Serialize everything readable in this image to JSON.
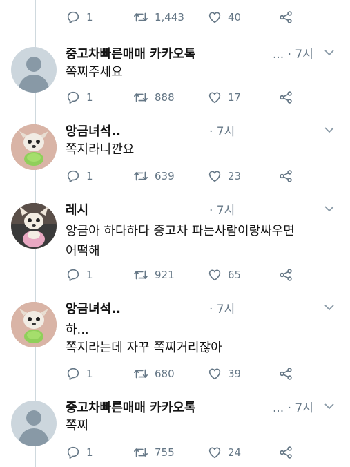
{
  "top_actions": {
    "reply": "1",
    "retweet": "1,443",
    "like": "40"
  },
  "tweets": [
    {
      "name": "중고차빠른매매 카카오톡",
      "meta": "... · 7시",
      "text_lines": [
        "쪽찌주세요"
      ],
      "reply": "1",
      "retweet": "888",
      "like": "17",
      "avatar": "default"
    },
    {
      "name": "앙금녀석..",
      "meta": "· 7시",
      "text_lines": [
        "쪽지라니깐요"
      ],
      "reply": "1",
      "retweet": "639",
      "like": "23",
      "avatar": "dog-green"
    },
    {
      "name": "레시",
      "meta": "· 7시",
      "text_lines": [
        "앙금아 하다하다 중고차 파는사람이랑싸우면",
        "어떡해"
      ],
      "reply": "1",
      "retweet": "921",
      "like": "65",
      "avatar": "dog-white"
    },
    {
      "name": "앙금녀석..",
      "meta": "· 7시",
      "text_lines": [
        "하...",
        "쪽지라는데 자꾸 쪽찌거리잖아"
      ],
      "reply": "1",
      "retweet": "680",
      "like": "39",
      "avatar": "dog-green"
    },
    {
      "name": "중고차빠른매매 카카오톡",
      "meta": "... · 7시",
      "text_lines": [
        "쪽찌"
      ],
      "reply": "1",
      "retweet": "755",
      "like": "24",
      "avatar": "default"
    }
  ]
}
